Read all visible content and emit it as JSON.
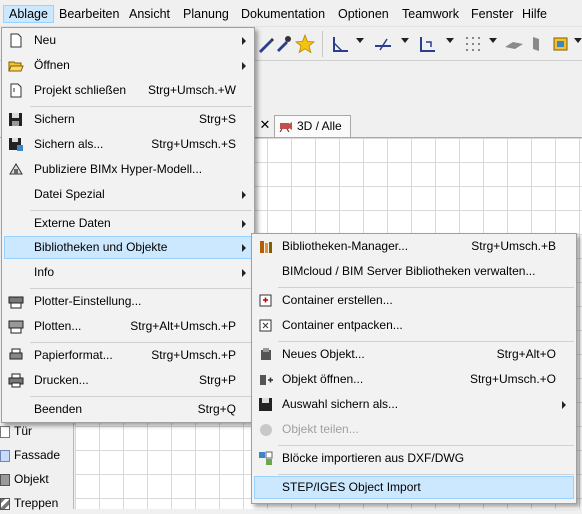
{
  "menubar": {
    "items": [
      "Ablage",
      "Bearbeiten",
      "Ansicht",
      "Planung",
      "Dokumentation",
      "Optionen",
      "Teamwork",
      "Fenster",
      "Hilfe"
    ]
  },
  "tabs": {
    "view_label": "3D / Alle"
  },
  "palette": {
    "items": [
      "Tür",
      "Fassade",
      "Objekt",
      "Treppen"
    ]
  },
  "file_menu": {
    "items": [
      {
        "label": "Neu",
        "shortcut": "",
        "submenu": true,
        "icon": "new-document-icon"
      },
      {
        "label": "Öffnen",
        "shortcut": "",
        "submenu": true,
        "icon": "open-folder-icon"
      },
      {
        "label": "Projekt schließen",
        "shortcut": "Strg+Umsch.+W",
        "submenu": false,
        "icon": "close-project-icon"
      },
      {
        "label": "Sichern",
        "shortcut": "Strg+S",
        "submenu": false,
        "icon": "save-icon"
      },
      {
        "label": "Sichern als...",
        "shortcut": "Strg+Umsch.+S",
        "submenu": false,
        "icon": "save-as-icon"
      },
      {
        "label": "Publiziere BIMx Hyper-Modell...",
        "shortcut": "",
        "submenu": false,
        "icon": "bimx-icon"
      },
      {
        "label": "Datei Spezial",
        "shortcut": "",
        "submenu": true,
        "icon": ""
      },
      {
        "label": "Externe Daten",
        "shortcut": "",
        "submenu": true,
        "icon": ""
      },
      {
        "label": "Bibliotheken und Objekte",
        "shortcut": "",
        "submenu": true,
        "icon": ""
      },
      {
        "label": "Info",
        "shortcut": "",
        "submenu": true,
        "icon": ""
      },
      {
        "label": "Plotter-Einstellung...",
        "shortcut": "",
        "submenu": false,
        "icon": "plotter-setup-icon"
      },
      {
        "label": "Plotten...",
        "shortcut": "Strg+Alt+Umsch.+P",
        "submenu": false,
        "icon": "plotter-icon"
      },
      {
        "label": "Papierformat...",
        "shortcut": "Strg+Umsch.+P",
        "submenu": false,
        "icon": "page-setup-icon"
      },
      {
        "label": "Drucken...",
        "shortcut": "Strg+P",
        "submenu": false,
        "icon": "printer-icon"
      },
      {
        "label": "Beenden",
        "shortcut": "Strg+Q",
        "submenu": false,
        "icon": ""
      }
    ]
  },
  "lib_menu": {
    "items": [
      {
        "label": "Bibliotheken-Manager...",
        "shortcut": "Strg+Umsch.+B",
        "submenu": false,
        "disabled": false,
        "icon": "library-manager-icon"
      },
      {
        "label": "BIMcloud / BIM Server Bibliotheken verwalten...",
        "shortcut": "",
        "submenu": false,
        "disabled": false,
        "icon": ""
      },
      {
        "label": "Container erstellen...",
        "shortcut": "",
        "submenu": false,
        "disabled": false,
        "icon": "create-container-icon"
      },
      {
        "label": "Container entpacken...",
        "shortcut": "",
        "submenu": false,
        "disabled": false,
        "icon": "extract-container-icon"
      },
      {
        "label": "Neues Objekt...",
        "shortcut": "Strg+Alt+O",
        "submenu": false,
        "disabled": false,
        "icon": "new-object-icon"
      },
      {
        "label": "Objekt öffnen...",
        "shortcut": "Strg+Umsch.+O",
        "submenu": false,
        "disabled": false,
        "icon": "open-object-icon"
      },
      {
        "label": "Auswahl sichern als...",
        "shortcut": "",
        "submenu": true,
        "disabled": false,
        "icon": "save-selection-icon"
      },
      {
        "label": "Objekt teilen...",
        "shortcut": "",
        "submenu": false,
        "disabled": true,
        "icon": "share-object-icon"
      },
      {
        "label": "Blöcke importieren aus DXF/DWG",
        "shortcut": "",
        "submenu": false,
        "disabled": false,
        "icon": "import-blocks-icon"
      },
      {
        "label": "STEP/IGES Object Import",
        "shortcut": "",
        "submenu": false,
        "disabled": false,
        "icon": ""
      }
    ]
  }
}
